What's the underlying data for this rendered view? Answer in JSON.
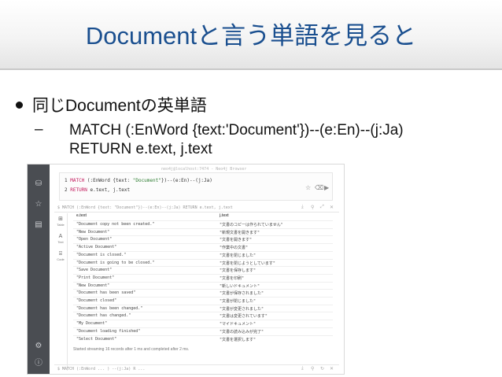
{
  "slide": {
    "title": "Documentと言う単語を見ると",
    "bullet": "同じDocumentの英単語",
    "sub_dash": "–",
    "sub_text": "MATCH (:EnWord {text:'Document'})--(e:En)--(j:Ja)\nRETURN e.text, j.text"
  },
  "screenshot": {
    "url": "neo4j@localhost:7474 - Neo4j Browser",
    "editor_line1_num": "1",
    "editor_line1_kw": "MATCH",
    "editor_line1_a": " (:EnWord {text: ",
    "editor_line1_str": "\"Document\"",
    "editor_line1_b": "})--(e:En)--(j:Ja)",
    "editor_line2_num": "2",
    "editor_line2_kw": "RETURN",
    "editor_line2_a": " e.text, j.text",
    "result_query": "$ MATCH (:EnWord {text: \"Document\"})--(e:En)--(j:Ja) RETURN e.text, j.text",
    "bottom_query": "$ MATCH (:EnWord ... ) --(j:Ja) R ... ",
    "tabs": [
      {
        "glyph": "⊞",
        "label": "Table"
      },
      {
        "glyph": "A",
        "label": "Text"
      },
      {
        "glyph": "⌸",
        "label": "Code"
      }
    ],
    "columns": [
      "e.text",
      "j.text"
    ],
    "rows": [
      [
        "\"Document copy not been created.\"",
        "\"文書のコピーは作られていません\""
      ],
      [
        "\"New Document\"",
        "\"新規文書を開きます\""
      ],
      [
        "\"Open Document\"",
        "\"文書を開きます\""
      ],
      [
        "\"Active Document\"",
        "\"作業中の文書\""
      ],
      [
        "\"Document is closed.\"",
        "\"文書を閉じました\""
      ],
      [
        "\"Document is going to be closed.\"",
        "\"文書を閉じようとしています\""
      ],
      [
        "\"Save Document\"",
        "\"文書を保存します\""
      ],
      [
        "\"Print Document\"",
        "\"文書を印刷\""
      ],
      [
        "\"New Document\"",
        "\"新しいドキュメント\""
      ],
      [
        "\"Document has been saved\"",
        "\"文書が保存されました\""
      ],
      [
        "\"Document closed\"",
        "\"文書が閉じました\""
      ],
      [
        "\"Document has been changed.\"",
        "\"文書が変更されました\""
      ],
      [
        "\"Document has changed.\"",
        "\"文書は変更されています\""
      ],
      [
        "\"My Document\"",
        "\"マイドキュメント\""
      ],
      [
        "\"Document loading finished\"",
        "\"文書の読み込みが完了\""
      ],
      [
        "\"Select Document\"",
        "\"文書を選択します\""
      ]
    ],
    "footer": "Started streaming 16 records after 1 ms and completed after 2 ms."
  },
  "icons": [
    "database-icon",
    "star-icon",
    "document-icon",
    "settings-icon",
    "info-icon",
    "pin-icon",
    "expand-icon",
    "close-icon",
    "refresh-icon",
    "play-icon",
    "download-icon"
  ],
  "colors": {
    "title": "#1a4f8f",
    "sidebar": "#4a4d52",
    "keyword": "#c2185b",
    "string": "#2e7d32"
  }
}
